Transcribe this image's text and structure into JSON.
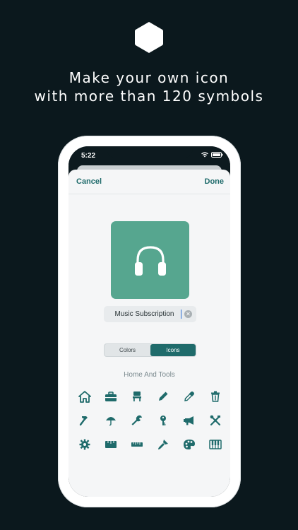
{
  "headline": {
    "line1": "Make your own icon",
    "line2": "with more than 120 symbols"
  },
  "status_bar": {
    "time": "5:22"
  },
  "nav": {
    "cancel_label": "Cancel",
    "done_label": "Done"
  },
  "icon_preview": {
    "background": "#56a68f",
    "symbol": "headphones-icon"
  },
  "name_field": {
    "value": "Music Subscription"
  },
  "segmented": {
    "colors_label": "Colors",
    "icons_label": "Icons",
    "selected": "Icons"
  },
  "section": {
    "title": "Home And Tools"
  },
  "accent_color": "#1f6b6b",
  "icons": [
    "house-icon",
    "toolbox-icon",
    "chair-icon",
    "pencil-icon",
    "dropper-icon",
    "trash-icon",
    "hammer-icon",
    "umbrella-icon",
    "wrench-icon",
    "key-icon",
    "megaphone-icon",
    "tools-crossed-icon",
    "gear-icon",
    "tape-measure-icon",
    "ruler-icon",
    "brush-icon",
    "palette-icon",
    "piano-icon"
  ]
}
